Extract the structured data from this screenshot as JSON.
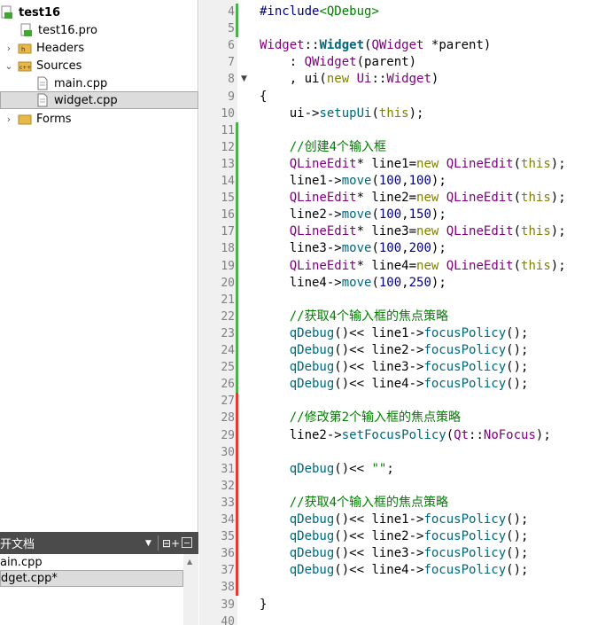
{
  "project_tree": {
    "project_name": "test16",
    "items": [
      {
        "label": "test16.pro",
        "icon": "pro-file-icon"
      },
      {
        "label": "Headers",
        "icon": "headers-folder-icon"
      },
      {
        "label": "Sources",
        "icon": "sources-folder-icon"
      },
      {
        "label": "main.cpp",
        "icon": "cpp-file-icon"
      },
      {
        "label": "widget.cpp",
        "icon": "cpp-file-icon"
      },
      {
        "label": "Forms",
        "icon": "forms-folder-icon"
      }
    ]
  },
  "open_documents": {
    "title": "开文档",
    "files": [
      "ain.cpp",
      "dget.cpp*"
    ]
  },
  "editor": {
    "line_numbers": [
      "4",
      "5",
      "6",
      "7",
      "8",
      "9",
      "10",
      "11",
      "12",
      "13",
      "14",
      "15",
      "16",
      "17",
      "18",
      "19",
      "20",
      "21",
      "22",
      "23",
      "24",
      "25",
      "26",
      "27",
      "28",
      "29",
      "30",
      "31",
      "32",
      "33",
      "34",
      "35",
      "36",
      "37",
      "38",
      "39",
      "40"
    ],
    "comments": {
      "c1": "//创建4个输入框",
      "c2": "//获取4个输入框的焦点策略",
      "c3": "//修改第2个输入框的焦点策略",
      "c4": "//获取4个输入框的焦点策略"
    }
  }
}
